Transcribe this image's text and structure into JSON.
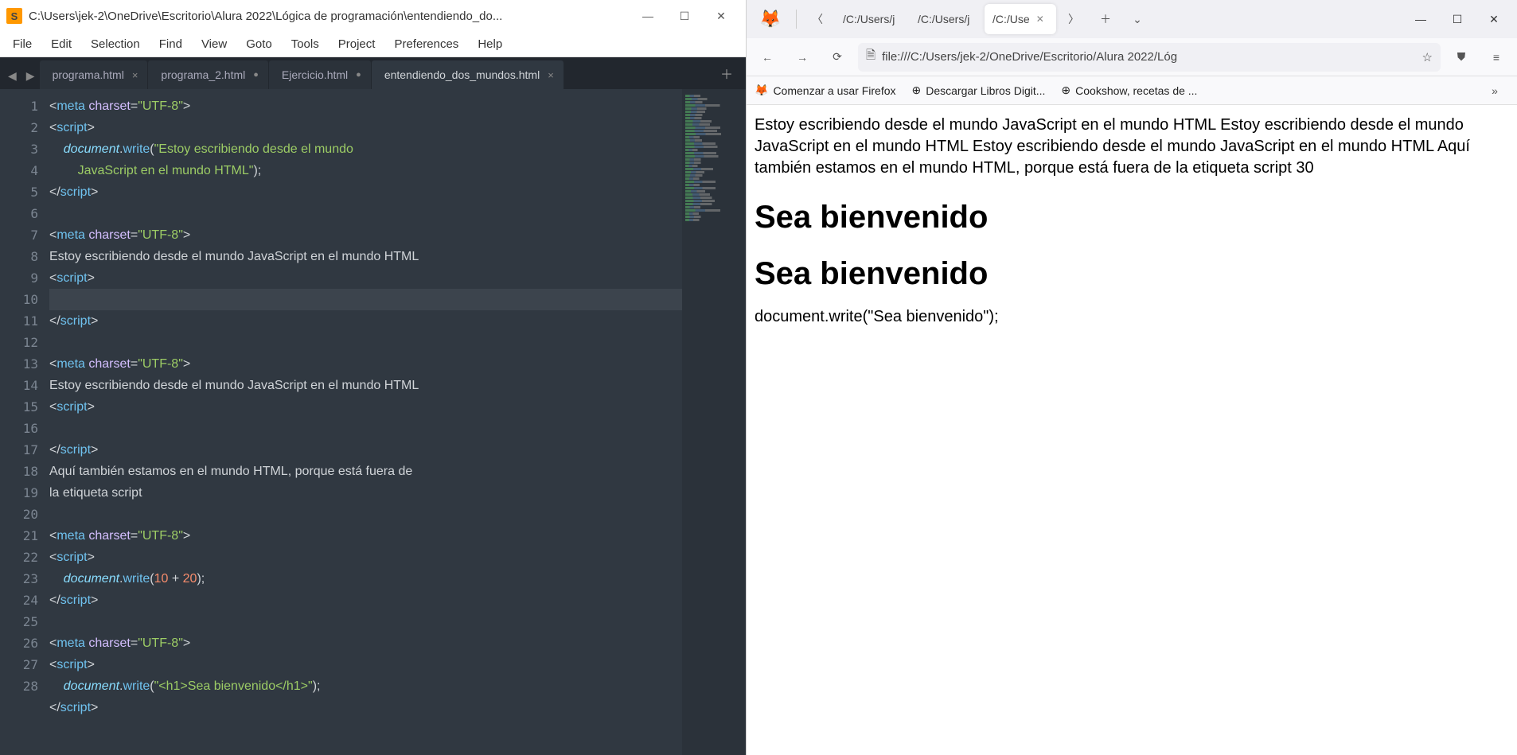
{
  "sublime": {
    "title": "C:\\Users\\jek-2\\OneDrive\\Escritorio\\Alura 2022\\Lógica de programación\\entendiendo_do...",
    "menu": [
      "File",
      "Edit",
      "Selection",
      "Find",
      "View",
      "Goto",
      "Tools",
      "Project",
      "Preferences",
      "Help"
    ],
    "tabs": [
      {
        "label": "programa.html",
        "active": false,
        "dirty": false
      },
      {
        "label": "programa_2.html",
        "active": false,
        "dirty": true
      },
      {
        "label": "Ejercicio.html",
        "active": false,
        "dirty": true
      },
      {
        "label": "entendiendo_dos_mundos.html",
        "active": true,
        "dirty": false
      }
    ],
    "lines": [
      "1",
      "2",
      "3",
      "",
      "4",
      "5",
      "6",
      "7",
      "8",
      "9",
      "10",
      "11",
      "12",
      "13",
      "14",
      "15",
      "16",
      "17",
      "",
      "18",
      "19",
      "20",
      "21",
      "22",
      "23",
      "24",
      "25",
      "26",
      "27",
      "28"
    ],
    "code": {
      "meta": "meta",
      "charset_attr": "charset",
      "utf8": "\"UTF-8\"",
      "script": "script",
      "document": "document",
      "write": "write",
      "str1": "\"Estoy escribiendo desde el mundo ",
      "str1b": "JavaScript en el mundo HTML\"",
      "plain1": "Estoy escribiendo desde el mundo JavaScript en el mundo HTML",
      "plain2": "Estoy escribiendo desde el mundo JavaScript en el mundo HTML",
      "plain3": "Aquí también estamos en el mundo HTML, porque está fuera de ",
      "plain3b": "la etiqueta script",
      "n10": "10",
      "n20": "20",
      "plus": " + ",
      "strh1": "\"<h1>Sea bienvenido</h1>\""
    }
  },
  "firefox": {
    "tabs": [
      {
        "label": "/C:/Users/j",
        "active": false
      },
      {
        "label": "/C:/Users/j",
        "active": false
      },
      {
        "label": "/C:/Use",
        "active": true
      }
    ],
    "url": "file:///C:/Users/jek-2/OneDrive/Escritorio/Alura 2022/Lóg",
    "bookmarks": [
      {
        "icon": "🦊",
        "label": "Comenzar a usar Firefox"
      },
      {
        "icon": "⊕",
        "label": "Descargar Libros Digit..."
      },
      {
        "icon": "⊕",
        "label": "Cookshow, recetas de ..."
      }
    ],
    "page": {
      "para": "Estoy escribiendo desde el mundo JavaScript en el mundo HTML Estoy escribiendo desde el mundo JavaScript en el mundo HTML Estoy escribiendo desde el mundo JavaScript en el mundo HTML Aquí también estamos en el mundo HTML, porque está fuera de la etiqueta script 30",
      "h1a": "Sea bienvenido",
      "h1b": "Sea bienvenido",
      "src": "document.write(\"Sea bienvenido\");"
    }
  }
}
